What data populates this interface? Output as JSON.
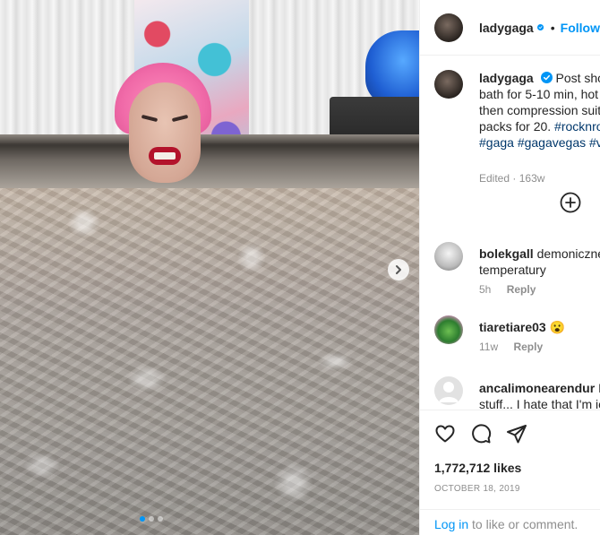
{
  "colors": {
    "accent": "#0095f6",
    "text": "#262626",
    "muted": "#8e8e8e",
    "hashtag": "#00376b"
  },
  "photo": {
    "carousel_total": 3,
    "carousel_active": 1
  },
  "header": {
    "username": "ladygaga",
    "separator": "•",
    "follow_label": "Follow"
  },
  "caption": {
    "username": "ladygaga",
    "lines": [
      "Post show",
      "bath for 5-10 min, hot",
      "then compression suit",
      "packs for 20. "
    ],
    "tags_line3": "#rocknro",
    "tags_line4": "#gaga #gagavegas #vi",
    "edited": "Edited",
    "meta_sep": "·",
    "age": "163w"
  },
  "comments": [
    {
      "username": "bolekgall",
      "text": "demoniczne",
      "text2": "temperatury",
      "age": "5h",
      "reply_label": "Reply"
    },
    {
      "username": "tiaretiare03",
      "text": "😮",
      "age": "11w",
      "reply_label": "Reply"
    },
    {
      "username": "ancalimonearendur",
      "text": "I",
      "text2": "stuff... I hate that I'm ic"
    }
  ],
  "actions": {
    "likes": "1,772,712 likes",
    "date": "OCTOBER 18, 2019"
  },
  "footer": {
    "login_link": "Log in",
    "login_rest": " to like or comment."
  }
}
